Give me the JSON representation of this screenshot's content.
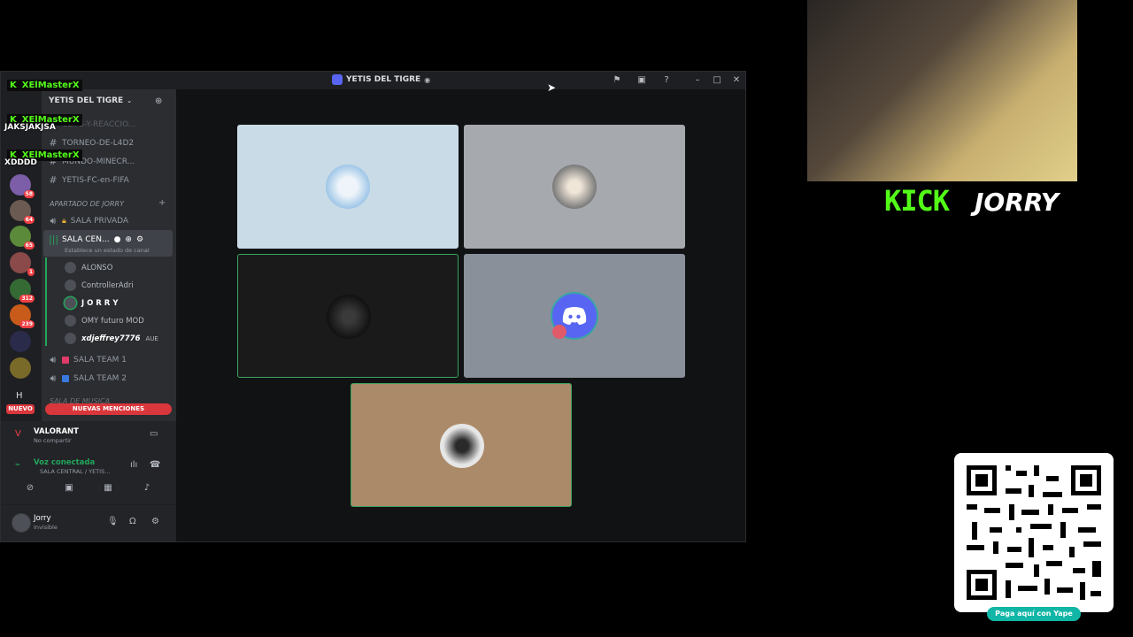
{
  "window": {
    "title": "YETIS DEL TIGRE",
    "controls": [
      "flag-icon",
      "inbox-icon",
      "help-icon",
      "minimize-icon",
      "maximize-icon",
      "close-icon"
    ]
  },
  "server": {
    "name": "YETIS DEL TIGRE",
    "channels_top": [
      {
        "name": "CLIPS-Y-REACCIO..."
      },
      {
        "name": "TORNEO-DE-L4D2"
      },
      {
        "name": "MUNDO-MINECR..."
      },
      {
        "name": "YETIS-FC-en-FIFA"
      }
    ],
    "category": "APARTADO DE JORRY",
    "voice_channels": [
      {
        "name": "SALA PRIVADA"
      },
      {
        "name": "SALA CEN..."
      }
    ],
    "status_hint": "Establece un estado de canal",
    "members": [
      {
        "name": "ALONSO"
      },
      {
        "name": "ControllerAdri"
      },
      {
        "name": "J O R R Y"
      },
      {
        "name": "OMY futuro MOD"
      },
      {
        "name": "xdjeffrey7776",
        "tag": "AUE"
      }
    ],
    "voice_channels_more": [
      {
        "name": "SALA TEAM 1"
      },
      {
        "name": "SALA TEAM 2"
      }
    ],
    "category_2": "SALA DE MUSICA"
  },
  "rail": {
    "badges": [
      "58",
      "64",
      "65",
      "1",
      "312",
      "239"
    ],
    "letter": "H",
    "new_label": "NUEVO"
  },
  "new_mentions": "NUEVAS MENCIONES",
  "activity": {
    "game": "VALORANT",
    "status": "No compartir"
  },
  "voice": {
    "status": "Voz conectada",
    "channel": "SALA CENTRAL / YETIS..."
  },
  "user": {
    "name": "Jorry",
    "status": "Invisible"
  },
  "overlay_chat": [
    {
      "user": "XElMasterX"
    },
    {
      "user": "XElMasterX",
      "msg": "JAKSJAKJSA"
    },
    {
      "user": "XElMasterX",
      "msg": "XDDDD"
    }
  ],
  "stream": {
    "platform": "KICK",
    "streamer": "JORRY",
    "qr_label": "Paga aquí con Yape"
  },
  "colors": {
    "kick_green": "#53fc18",
    "discord_bg": "#2b2d31",
    "speaking": "#3ba55d",
    "mention_red": "#da373c"
  }
}
